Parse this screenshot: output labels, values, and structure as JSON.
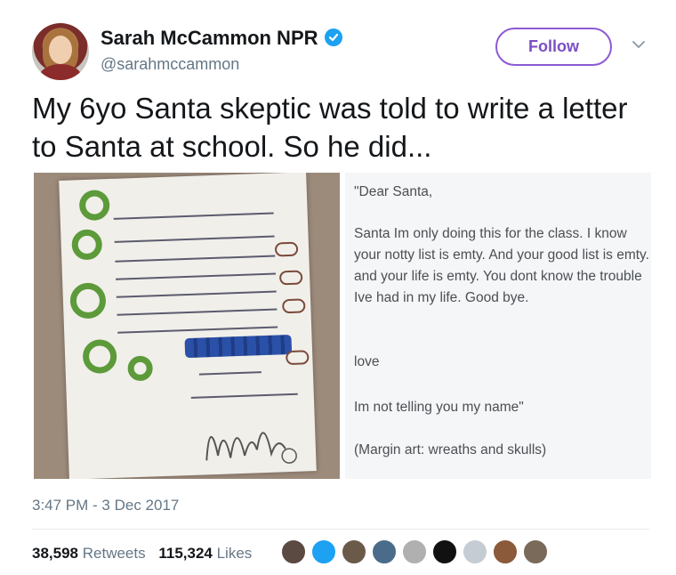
{
  "author": {
    "name": "Sarah McCammon NPR",
    "handle": "@sarahmccammon",
    "verified": true,
    "avatar_icon": "profile-photo"
  },
  "follow_label": "Follow",
  "tweet_text": "My 6yo Santa skeptic was told to write a letter to Santa at school. So he did...",
  "transcript": {
    "greeting": "\"Dear Santa,",
    "body": "Santa Im only doing this for the class. I know your notty list is emty. And your good list is emty. and your life is emty. You dont know the trouble Ive had in my life. Good bye.",
    "closing": "love",
    "signature": "Im not telling you my name\"",
    "margin_note": "(Margin art: wreaths and skulls)"
  },
  "timestamp": "3:47 PM - 3 Dec 2017",
  "stats": {
    "retweets_count": "38,598",
    "retweets_label": "Retweets",
    "likes_count": "115,324",
    "likes_label": "Likes"
  },
  "likers_colors": [
    "#5b4a42",
    "#1da1f2",
    "#6b5a4a",
    "#4a6b8a",
    "#b0b0b0",
    "#111111",
    "#c5ccd3",
    "#8a5a3a",
    "#7a6a5a"
  ],
  "colors": {
    "follow_accent": "#7a4fc5",
    "verified": "#1da1f2",
    "secondary_text": "#657786"
  }
}
